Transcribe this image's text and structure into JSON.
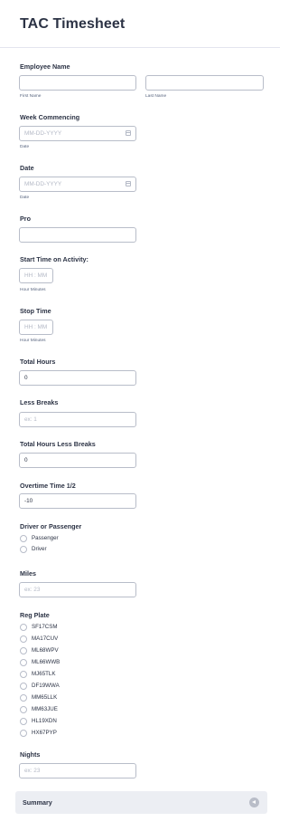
{
  "form": {
    "title": "TAC Timesheet"
  },
  "employee_name": {
    "label": "Employee Name",
    "first_sublabel": "First Name",
    "last_sublabel": "Last Name",
    "first_value": "",
    "last_value": ""
  },
  "week_commencing": {
    "label": "Week Commencing",
    "placeholder": "MM-DD-YYYY",
    "sublabel": "Date",
    "icon": "calendar-icon"
  },
  "date": {
    "label": "Date",
    "placeholder": "MM-DD-YYYY",
    "sublabel": "Date",
    "icon": "calendar-icon"
  },
  "pro": {
    "label": "Pro",
    "value": ""
  },
  "start_time": {
    "label": "Start Time on Activity:",
    "placeholder": "HH : MM",
    "sublabel": "Hour Minutes"
  },
  "stop_time": {
    "label": "Stop Time",
    "placeholder": "HH : MM",
    "sublabel": "Hour Minutes"
  },
  "total_hours": {
    "label": "Total Hours",
    "value": "0"
  },
  "less_breaks": {
    "label": "Less Breaks",
    "placeholder": "ex: 1"
  },
  "total_less_breaks": {
    "label": "Total Hours Less Breaks",
    "value": "0"
  },
  "overtime": {
    "label": "Overtime Time 1/2",
    "value": "-10"
  },
  "driver_passenger": {
    "label": "Driver or Passenger",
    "options": [
      "Passenger",
      "Driver"
    ]
  },
  "miles": {
    "label": "Miles",
    "placeholder": "ex: 23"
  },
  "reg_plate": {
    "label": "Reg Plate",
    "options": [
      "SF17CSM",
      "MA17CUV",
      "ML68WPV",
      "ML66WWB",
      "MJ65TLK",
      "DF19WWA",
      "MM65LLK",
      "MM63JUE",
      "HL19XDN",
      "HX67PYP"
    ]
  },
  "nights": {
    "label": "Nights",
    "placeholder": "ex: 23"
  },
  "summary": {
    "label": "Summary",
    "icon": "chevron-left-icon"
  }
}
